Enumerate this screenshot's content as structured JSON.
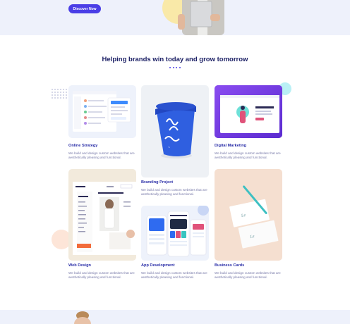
{
  "hero": {
    "button_label": "Discover Now"
  },
  "section": {
    "title": "Helping brands win today and grow tomorrow"
  },
  "services": [
    {
      "title": "Online Strategy",
      "description": "We build and design custom websites that are aesthetically pleasing and functional."
    },
    {
      "title": "Branding Project",
      "description": "We build and design custom websites that are aesthetically pleasing and functional."
    },
    {
      "title": "Digital Marketing",
      "description": "We build and design custom websites that are aesthetically pleasing and functional."
    },
    {
      "title": "Web Design",
      "description": "We build and design custom websites that are aesthetically pleasing and functional."
    },
    {
      "title": "App Development",
      "description": "We build and design custom websites that are aesthetically pleasing and functional."
    },
    {
      "title": "Business Cards",
      "description": "We build and design custom websites that are aesthetically pleasing and functional."
    }
  ],
  "colors": {
    "accent": "#4a3ee6",
    "heading": "#1d2166",
    "card_title": "#2b2fa8",
    "body_text": "#7779a8",
    "hero_bg": "#eef1fb"
  }
}
